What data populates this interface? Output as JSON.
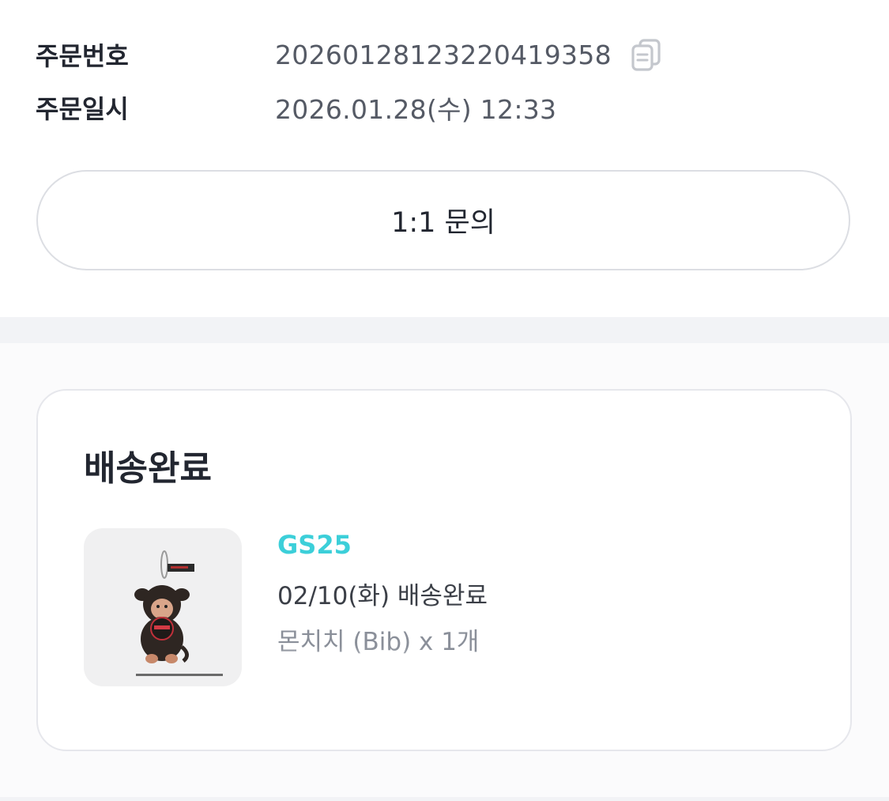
{
  "order_info": {
    "order_number_label": "주문번호",
    "order_number_value": "20260128123220419358",
    "order_date_label": "주문일시",
    "order_date_value": "2026.01.28(수) 12:33",
    "copy_icon": "copy-icon"
  },
  "inquiry_button": {
    "label": "1:1 문의"
  },
  "delivery_card": {
    "status_title": "배송완료",
    "store_name": "GS25",
    "delivery_status": "02/10(화) 배송완료",
    "product_name": "몬치치 (Bib) x 1개",
    "thumbnail_icon": "monchhichi-plush-keychain",
    "store_color": "#3ccfd9"
  }
}
